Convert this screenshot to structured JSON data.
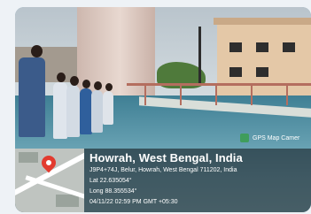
{
  "badge": {
    "label": "GPS Map Camer"
  },
  "location": {
    "city": "Howrah, West Bengal, India",
    "address": "J9P4+74J, Belur, Howrah, West Bengal 711202, India",
    "lat": "Lat 22.635054°",
    "long": "Long 88.355534°",
    "timestamp": "04/11/22 02:59 PM GMT +05:30"
  },
  "icons": {
    "marker": "location-pin-icon",
    "badge": "gps-map-camera-icon"
  },
  "colors": {
    "pin": "#e23b2f",
    "badge": "#3f9d5c",
    "overlay": "#192026"
  }
}
